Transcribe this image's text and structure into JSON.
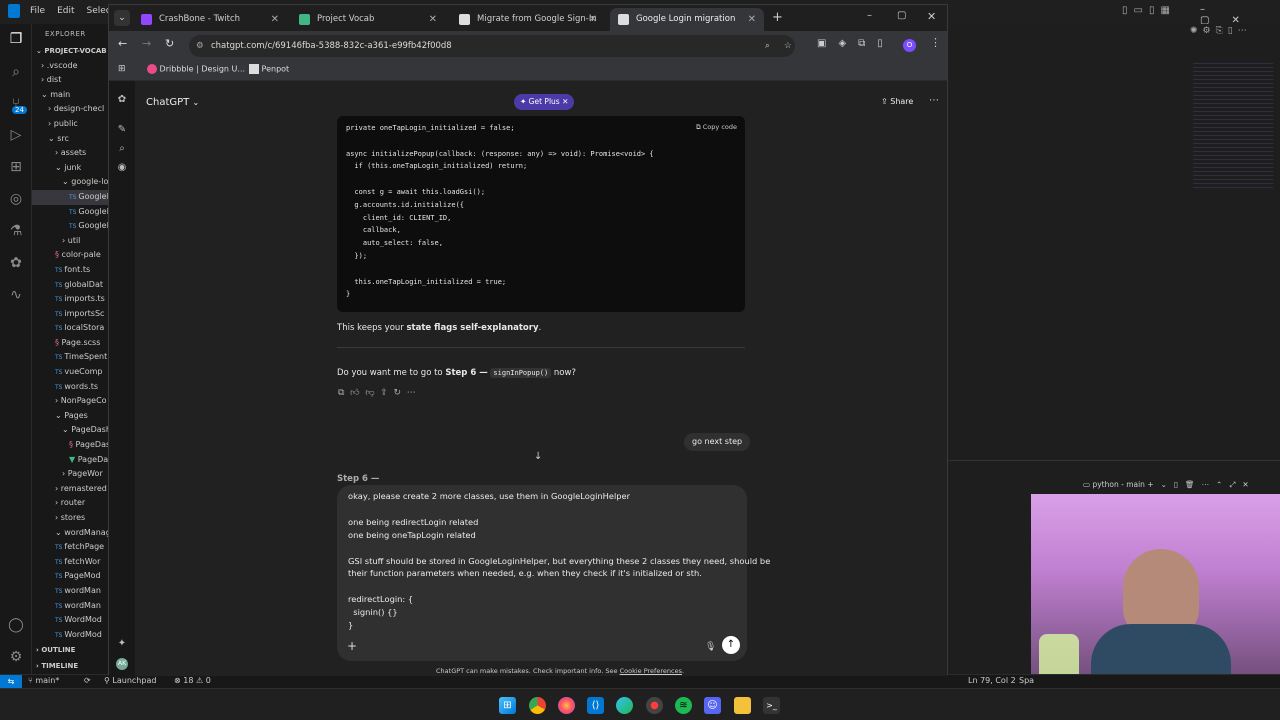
{
  "vscode": {
    "menu": [
      "File",
      "Edit",
      "Selectio"
    ],
    "explorer_title": "EXPLORER",
    "project": "PROJECT-VOCAB",
    "tree": [
      {
        "label": ".vscode",
        "indent": 1,
        "type": "folder"
      },
      {
        "label": "dist",
        "indent": 1,
        "type": "folder"
      },
      {
        "label": "main",
        "indent": 1,
        "type": "folder-open"
      },
      {
        "label": "design-checl",
        "indent": 2,
        "type": "folder"
      },
      {
        "label": "public",
        "indent": 2,
        "type": "folder"
      },
      {
        "label": "src",
        "indent": 2,
        "type": "folder-open"
      },
      {
        "label": "assets",
        "indent": 3,
        "type": "folder"
      },
      {
        "label": "junk",
        "indent": 3,
        "type": "folder-open"
      },
      {
        "label": "google-lo",
        "indent": 4,
        "type": "folder-open"
      },
      {
        "label": "GoogleL",
        "indent": 5,
        "type": "ts",
        "selected": true
      },
      {
        "label": "GoogleL",
        "indent": 5,
        "type": "ts"
      },
      {
        "label": "GoogleL",
        "indent": 5,
        "type": "ts"
      },
      {
        "label": "util",
        "indent": 4,
        "type": "folder"
      },
      {
        "label": "color-pale",
        "indent": 3,
        "type": "scss"
      },
      {
        "label": "font.ts",
        "indent": 3,
        "type": "ts"
      },
      {
        "label": "globalDat",
        "indent": 3,
        "type": "ts"
      },
      {
        "label": "imports.ts",
        "indent": 3,
        "type": "ts"
      },
      {
        "label": "importsSc",
        "indent": 3,
        "type": "ts"
      },
      {
        "label": "localStora",
        "indent": 3,
        "type": "ts"
      },
      {
        "label": "Page.scss",
        "indent": 3,
        "type": "scss"
      },
      {
        "label": "TimeSpent",
        "indent": 3,
        "type": "ts"
      },
      {
        "label": "vueComp",
        "indent": 3,
        "type": "ts"
      },
      {
        "label": "words.ts",
        "indent": 3,
        "type": "ts"
      },
      {
        "label": "NonPageCo",
        "indent": 3,
        "type": "folder"
      },
      {
        "label": "Pages",
        "indent": 3,
        "type": "folder-open"
      },
      {
        "label": "PageDash",
        "indent": 4,
        "type": "folder-open"
      },
      {
        "label": "PageDas",
        "indent": 5,
        "type": "scss"
      },
      {
        "label": "PageDas",
        "indent": 5,
        "type": "vue"
      },
      {
        "label": "PageWor",
        "indent": 4,
        "type": "folder"
      },
      {
        "label": "remastered",
        "indent": 3,
        "type": "folder"
      },
      {
        "label": "router",
        "indent": 3,
        "type": "folder"
      },
      {
        "label": "stores",
        "indent": 3,
        "type": "folder"
      },
      {
        "label": "wordManag",
        "indent": 3,
        "type": "folder-open"
      },
      {
        "label": "fetchPage",
        "indent": 3,
        "type": "ts"
      },
      {
        "label": "fetchWor",
        "indent": 3,
        "type": "ts"
      },
      {
        "label": "PageMod",
        "indent": 3,
        "type": "ts"
      },
      {
        "label": "wordMan",
        "indent": 3,
        "type": "ts"
      },
      {
        "label": "wordMan",
        "indent": 3,
        "type": "ts"
      },
      {
        "label": "WordMod",
        "indent": 3,
        "type": "ts"
      },
      {
        "label": "WordMod",
        "indent": 3,
        "type": "ts"
      }
    ],
    "outline": "OUTLINE",
    "timeline": "TIMELINE",
    "activity_badge": "24",
    "status": {
      "branch": "main*",
      "launchpad": "Launchpad",
      "problems": "18",
      "warnings": "0",
      "position": "Ln 79, Col 2",
      "spaces": "Spa"
    },
    "terminal_label": "python - main"
  },
  "chrome": {
    "tabs": [
      {
        "title": "CrashBone - Twitch",
        "favicon_color": "#9146ff"
      },
      {
        "title": "Project Vocab",
        "favicon_color": "#41b883"
      },
      {
        "title": "Migrate from Google Sign-In",
        "favicon_color": "#dddddd"
      },
      {
        "title": "Google Login migration",
        "favicon_color": "#dddddd",
        "active": true
      }
    ],
    "url": "chatgpt.com/c/69146fba-5388-832c-a361-e99fb42f00d8",
    "profile_initial": "O",
    "bookmarks": [
      "Dribbble | Design U...",
      "Penpot"
    ]
  },
  "chatgpt": {
    "model": "ChatGPT",
    "get_plus": "Get Plus",
    "share": "Share",
    "copy_code": "Copy code",
    "code_lines": [
      "private oneTapLogin_initialized = false;",
      "",
      "async initializePopup(callback: (response: any) => void): Promise<void> {",
      "  if (this.oneTapLogin_initialized) return;",
      "",
      "  const g = await this.loadGsi();",
      "  g.accounts.id.initialize({",
      "    client_id: CLIENT_ID,",
      "    callback,",
      "    auto_select: false,",
      "  });",
      "",
      "  this.oneTapLogin_initialized = true;",
      "}"
    ],
    "explain_pre": "This keeps your ",
    "explain_bold": "state flags self-explanatory",
    "explain_post": ".",
    "question_pre": "Do you want me to go to ",
    "question_bold": "Step 6 —",
    "question_code": "signInPopup()",
    "question_post": " now?",
    "user_message": "go next step",
    "partial_next": "Step 6 —",
    "composer_lines": [
      "okay, please create 2 more classes, use them in GoogleLoginHelper",
      "",
      "one being redirectLogin related",
      "one being oneTapLogin related",
      "",
      "GSI stuff should be stored in GoogleLoginHelper, but everything these 2 classes they need, should be",
      "their function parameters when needed, e.g. when they check if it's initialized or sth.",
      "",
      "redirectLogin: {",
      "  signin() {}",
      "}"
    ],
    "disclaimer_pre": "ChatGPT can make mistakes. Check important info. See ",
    "disclaimer_link": "Cookie Preferences",
    "disclaimer_post": "."
  }
}
